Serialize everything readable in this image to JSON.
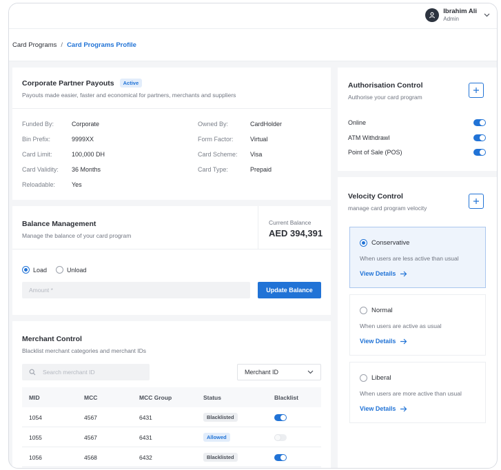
{
  "user": {
    "name": "Ibrahim Ali",
    "role": "Admin"
  },
  "breadcrumb": {
    "parent": "Card Programs",
    "separator": "/",
    "current": "Card Programs Profile"
  },
  "program": {
    "title": "Corporate Partner Payouts",
    "status": "Active",
    "subtitle": "Payouts made easier, faster and economical for partners, merchants and suppliers",
    "details_left": [
      {
        "label": "Funded By:",
        "value": "Corporate"
      },
      {
        "label": "Bin Prefix:",
        "value": "9999XX"
      },
      {
        "label": "Card Limit:",
        "value": "100,000 DH"
      },
      {
        "label": "Card Validity:",
        "value": "36 Months"
      },
      {
        "label": "Reloadable:",
        "value": "Yes"
      }
    ],
    "details_right": [
      {
        "label": "Owned By:",
        "value": "CardHolder"
      },
      {
        "label": "Form Factor:",
        "value": "Virtual"
      },
      {
        "label": "Card Scheme:",
        "value": "Visa"
      },
      {
        "label": "Card Type:",
        "value": "Prepaid"
      }
    ]
  },
  "balance": {
    "title": "Balance Management",
    "subtitle": "Manage the balance of your card program",
    "current_label": "Current Balance",
    "current_value": "AED 394,391",
    "load_label": "Load",
    "unload_label": "Unload",
    "selected": "load",
    "amount_placeholder": "Amount *",
    "update_button": "Update Balance"
  },
  "merchant": {
    "title": "Merchant Control",
    "subtitle": "Blacklist merchant categories and merchant IDs",
    "search_placeholder": "Search merchant ID",
    "filter_value": "Merchant ID",
    "columns": [
      "MID",
      "MCC",
      "MCC Group",
      "Status",
      "Blacklist"
    ],
    "rows": [
      {
        "mid": "1054",
        "mcc": "4567",
        "group": "6431",
        "status": "Blacklisted",
        "blacklist": true
      },
      {
        "mid": "1055",
        "mcc": "4567",
        "group": "6431",
        "status": "Allowed",
        "blacklist": false
      },
      {
        "mid": "1056",
        "mcc": "4568",
        "group": "6432",
        "status": "Blacklisted",
        "blacklist": true
      }
    ]
  },
  "authorisation": {
    "title": "Authorisation Control",
    "subtitle": "Authorise your card program",
    "items": [
      {
        "label": "Online",
        "on": true
      },
      {
        "label": "ATM Withdrawl",
        "on": true
      },
      {
        "label": "Point of Sale (POS)",
        "on": true
      }
    ]
  },
  "velocity": {
    "title": "Velocity Control",
    "subtitle": "manage card program velocity",
    "options": [
      {
        "name": "Conservative",
        "desc": "When users are less active than usual",
        "link": "View Details",
        "selected": true
      },
      {
        "name": "Normal",
        "desc": "When users are active as usual",
        "link": "View Details",
        "selected": false
      },
      {
        "name": "Liberal",
        "desc": "When users are more active than usual",
        "link": "View Details",
        "selected": false
      }
    ]
  },
  "colors": {
    "accent": "#2173d6",
    "background": "#f4f5f7"
  }
}
